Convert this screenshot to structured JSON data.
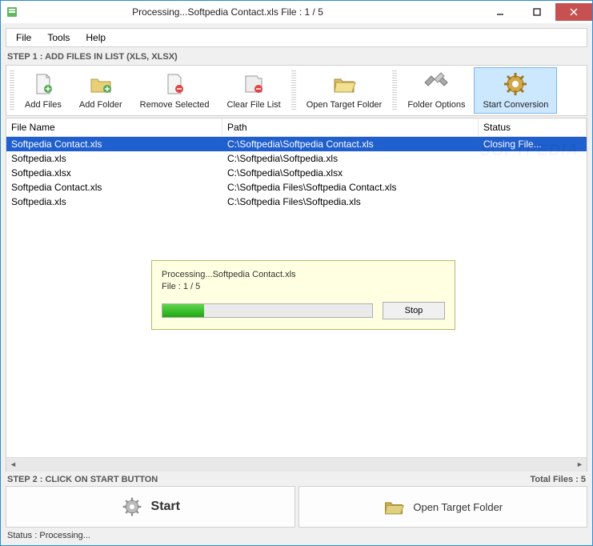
{
  "title": "Processing...Softpedia Contact.xls File : 1 / 5",
  "menu": {
    "file": "File",
    "tools": "Tools",
    "help": "Help"
  },
  "step1": "STEP 1 : ADD FILES IN LIST (XLS, XLSX)",
  "toolbar": {
    "add_files": "Add Files",
    "add_folder": "Add Folder",
    "remove_selected": "Remove Selected",
    "clear_list": "Clear File List",
    "open_target": "Open Target Folder",
    "folder_options": "Folder Options",
    "start_conversion": "Start Conversion"
  },
  "columns": {
    "name": "File Name",
    "path": "Path",
    "status": "Status"
  },
  "rows": [
    {
      "name": "Softpedia Contact.xls",
      "path": "C:\\Softpedia\\Softpedia Contact.xls",
      "status": "Closing File...",
      "selected": true
    },
    {
      "name": "Softpedia.xls",
      "path": "C:\\Softpedia\\Softpedia.xls",
      "status": "",
      "selected": false
    },
    {
      "name": "Softpedia.xlsx",
      "path": "C:\\Softpedia\\Softpedia.xlsx",
      "status": "",
      "selected": false
    },
    {
      "name": "Softpedia Contact.xls",
      "path": "C:\\Softpedia Files\\Softpedia Contact.xls",
      "status": "",
      "selected": false
    },
    {
      "name": "Softpedia.xls",
      "path": "C:\\Softpedia Files\\Softpedia.xls",
      "status": "",
      "selected": false
    }
  ],
  "watermark": "SOFTPEDIA",
  "step2": "STEP 2 : CLICK ON START BUTTON",
  "total_files": "Total Files : 5",
  "start_btn": "Start",
  "open_target_btn": "Open Target Folder",
  "status": "Status :  Processing...",
  "dialog": {
    "line1": "Processing...Softpedia Contact.xls",
    "line2": "File : 1 / 5",
    "progress_percent": 20,
    "stop": "Stop"
  }
}
